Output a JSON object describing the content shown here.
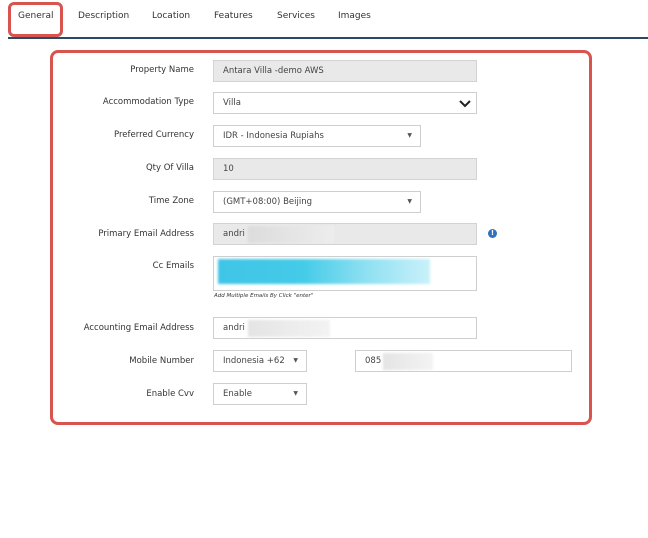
{
  "tabs": [
    {
      "label": "General"
    },
    {
      "label": "Description"
    },
    {
      "label": "Location"
    },
    {
      "label": "Features"
    },
    {
      "label": "Services"
    },
    {
      "label": "Images"
    }
  ],
  "form": {
    "property_name": {
      "label": "Property Name",
      "value": "Antara Villa -demo AWS"
    },
    "accommodation_type": {
      "label": "Accommodation Type",
      "value": "Villa"
    },
    "preferred_currency": {
      "label": "Preferred Currency",
      "value": "IDR - Indonesia Rupiahs"
    },
    "qty_of_villa": {
      "label": "Qty Of Villa",
      "value": "10"
    },
    "time_zone": {
      "label": "Time Zone",
      "value": "(GMT+08:00) Beijing"
    },
    "primary_email": {
      "label": "Primary Email Address",
      "value": "andri"
    },
    "cc_emails": {
      "label": "Cc Emails",
      "hint": "Add Multiple Emails By Click \"enter\""
    },
    "accounting_email": {
      "label": "Accounting Email Address",
      "value": "andri"
    },
    "mobile_number": {
      "label": "Mobile Number",
      "country": "Indonesia +62",
      "number": "085"
    },
    "enable_cvv": {
      "label": "Enable Cvv",
      "value": "Enable"
    }
  },
  "colors": {
    "highlight": "#d9534f",
    "tab_underline": "#2c4a66",
    "info_icon": "#2f72c4"
  }
}
